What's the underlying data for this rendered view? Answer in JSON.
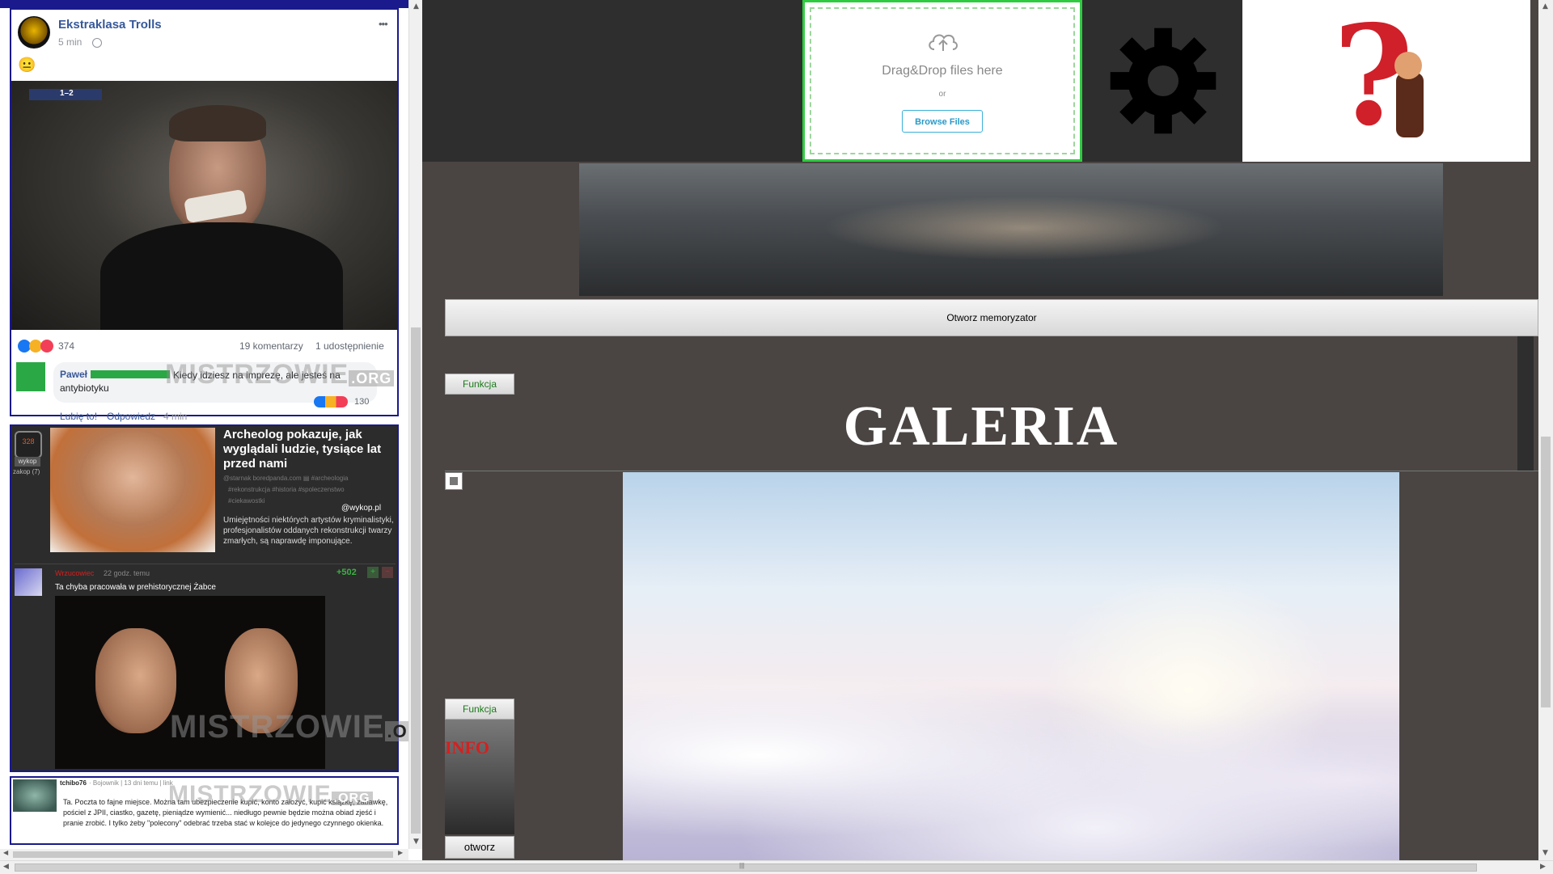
{
  "fb": {
    "page_name": "Ekstraklasa Trolls",
    "time": "5 min",
    "more": "•••",
    "emoji": "😐",
    "score": "1–2",
    "reactions_count": "374",
    "comments": "19 komentarzy",
    "shares": "1 udostępnienie",
    "comment_author": "Paweł",
    "comment_text": "Kiedy idziesz na imprezę, ale jesteś na antybiotyku",
    "comment_reactions": "130",
    "like_action": "Lubię to!",
    "reply_action": "Odpowiedz",
    "reply_time": "4 min",
    "watermark": "MISTRZOWIE",
    "watermark_suffix": ".ORG"
  },
  "wykop": {
    "votes": "328",
    "wykop_label": "wykop",
    "zakop_label": "zakop (7)",
    "title": "Archeolog pokazuje, jak wyglądali ludzie, tysiące lat przed nami",
    "meta": "@starnak boredpanda.com  ▤  #archeologia",
    "tags2": "#rekonstrukcja  #historia  #spoleczenstwo",
    "tags3": "#ciekawostki",
    "logo": "@wykop.pl",
    "description": "Umiejętności niektórych artystów kryminalistyki, profesjonalistów oddanych rekonstrukcji twarzy zmarłych, są naprawdę imponujące.",
    "commenter": "Wrzucowiec",
    "comment_time": "22 godz. temu",
    "comment_score": "+502",
    "plus": "+",
    "minus": "−",
    "comment_text": "Ta chyba pracowała w prehistorycznej Żabce",
    "watermark": "MISTRZOWIE",
    "watermark_suffix": ".ORG"
  },
  "tchibo": {
    "author": "tchibo76",
    "meta": "· Bojownik  |  13 dni temu  |  link",
    "text": "Ta. Poczta to fajne miejsce. Można tam ubezpieczenie kupić, konto założyć, kupić książkę, zabawkę, pościel z JPII, ciastko, gazetę, pieniądze wymienić... niedługo pewnie będzie można obiad zjeść i pranie zrobić. I tylko żeby \"polecony\" odebrać trzeba stać w kolejce do jedynego czynnego okienka.",
    "watermark": "MISTRZOWIE",
    "watermark_suffix": ".ORG"
  },
  "upload": {
    "drag_text": "Drag&Drop files here",
    "or_text": "or",
    "browse_label": "Browse Files"
  },
  "memoryzator_button": "Otworz memoryzator",
  "funkcja_label": "Funkcja",
  "funkcja_label_2": "Funkcja",
  "galeria_title": "GALERIA",
  "info_label": "INFO",
  "otworz_label": "otworz",
  "scroll_marker": "|||",
  "colors": {
    "accent_green": "#2aa845",
    "upload_border": "#2ecc40",
    "fb_blue": "#365899",
    "navy_border": "#1a1a8c",
    "info_red": "#d42020"
  }
}
